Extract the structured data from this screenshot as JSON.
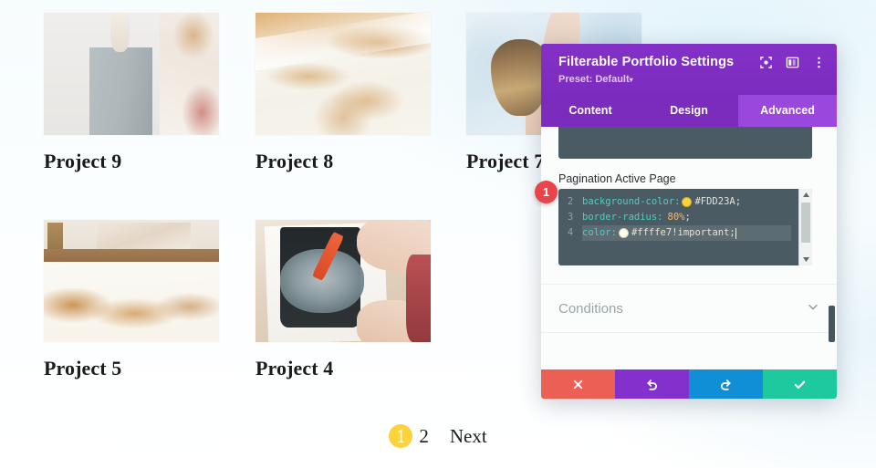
{
  "portfolio": {
    "projects": [
      {
        "title": "Project 9",
        "image": "gray-pedestal-photo"
      },
      {
        "title": "Project 8",
        "image": "ochre-watercolor-photo"
      },
      {
        "title": "Project 7",
        "image": "woman-arm-raised-photo"
      },
      {
        "title": "Project 5",
        "image": "painting-on-floor-photo"
      },
      {
        "title": "Project 4",
        "image": "hand-painting-brush-photo"
      }
    ]
  },
  "pagination": {
    "pages": [
      "1",
      "2"
    ],
    "active_page": "1",
    "next_label": "Next",
    "active_bg_color": "#FDD23A",
    "active_text_color": "#ffffe7"
  },
  "modal": {
    "title": "Filterable Portfolio Settings",
    "preset_label": "Preset: Default",
    "preset_caret": "▾",
    "header_icons": [
      {
        "name": "focus-icon"
      },
      {
        "name": "layout-columns-icon"
      },
      {
        "name": "more-vertical-icon"
      }
    ],
    "tabs": [
      {
        "label": "Content",
        "active": false
      },
      {
        "label": "Design",
        "active": false
      },
      {
        "label": "Advanced",
        "active": true
      }
    ],
    "field": {
      "label": "Pagination Active Page",
      "code_lines": [
        {
          "number": "2",
          "property": "background-color:",
          "swatch_color": "#FDD23A",
          "value": "#FDD23A",
          "suffix": ";",
          "selected": false
        },
        {
          "number": "3",
          "property": "border-radius:",
          "swatch_color": null,
          "value": "80%",
          "suffix": ";",
          "selected": false
        },
        {
          "number": "4",
          "property": "color:",
          "swatch_color": "#ffffe7",
          "value": "#ffffe7!important",
          "suffix": ";",
          "selected": true
        }
      ]
    },
    "conditions": {
      "label": "Conditions"
    },
    "footer_buttons": [
      {
        "name": "cancel-button",
        "icon": "times-icon",
        "color": "#EC5F54"
      },
      {
        "name": "undo-button",
        "icon": "undo-icon",
        "color": "#8330CD"
      },
      {
        "name": "redo-button",
        "icon": "redo-icon",
        "color": "#108ED6"
      },
      {
        "name": "save-button",
        "icon": "check-icon",
        "color": "#1FC9A0"
      }
    ],
    "accent_color": "#7B2CBD"
  },
  "annotations": {
    "marker_1": "1"
  }
}
